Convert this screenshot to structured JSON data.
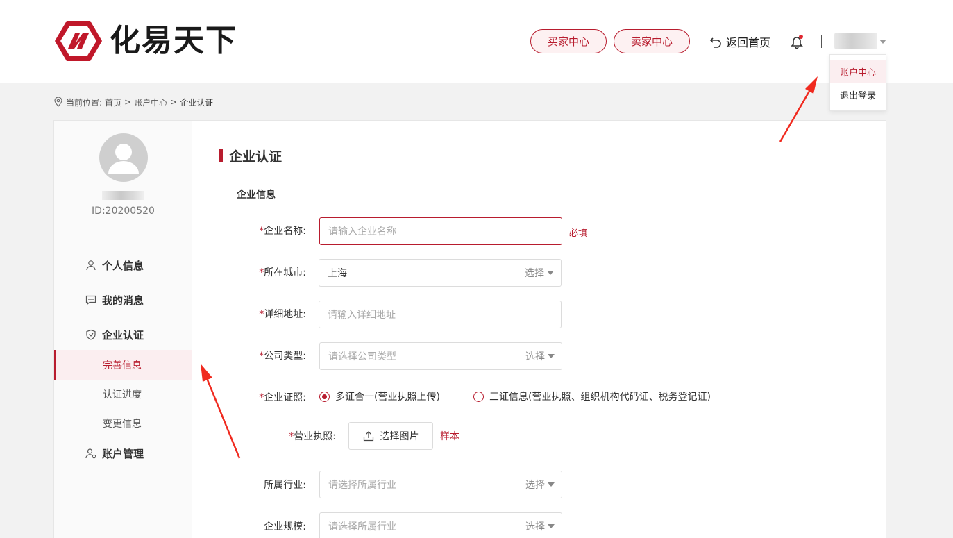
{
  "brand": {
    "name": "化易天下",
    "accent": "#b81c2e"
  },
  "header": {
    "buyer_center": "买家中心",
    "seller_center": "卖家中心",
    "back_home": "返回首页"
  },
  "user_menu": {
    "items": [
      {
        "label": "账户中心",
        "active": true
      },
      {
        "label": "退出登录",
        "active": false
      }
    ]
  },
  "breadcrumb": {
    "prefix": "当前位置:",
    "items": [
      "首页",
      "账户中心",
      "企业认证"
    ],
    "separator": ">"
  },
  "profile": {
    "id_text": "ID:20200520"
  },
  "sidebar": {
    "personal": "个人信息",
    "messages": "我的消息",
    "enterprise": "企业认证",
    "sub_items": [
      {
        "label": "完善信息",
        "active": true
      },
      {
        "label": "认证进度",
        "active": false
      },
      {
        "label": "变更信息",
        "active": false
      }
    ],
    "account": "账户管理"
  },
  "main": {
    "title": "企业认证",
    "subtitle": "企业信息",
    "required_mark": "*",
    "fields": {
      "company_name": {
        "label": "企业名称:",
        "placeholder": "请输入企业名称",
        "hint": "必填"
      },
      "city": {
        "label": "所在城市:",
        "value": "上海",
        "select": "选择"
      },
      "address": {
        "label": "详细地址:",
        "placeholder": "请输入详细地址"
      },
      "company_type": {
        "label": "公司类型:",
        "placeholder": "请选择公司类型",
        "select": "选择"
      },
      "license_mode": {
        "label": "企业证照:",
        "options": [
          {
            "label": "多证合一(营业执照上传)",
            "checked": true
          },
          {
            "label": "三证信息(营业执照、组织机构代码证、税务登记证)",
            "checked": false
          }
        ]
      },
      "business_license": {
        "label": "营业执照:",
        "button": "选择图片",
        "sample": "样本"
      },
      "industry": {
        "label": "所属行业:",
        "placeholder": "请选择所属行业",
        "select": "选择"
      },
      "scale": {
        "label": "企业规模:",
        "placeholder": "请选择所属行业",
        "select": "选择"
      }
    }
  }
}
